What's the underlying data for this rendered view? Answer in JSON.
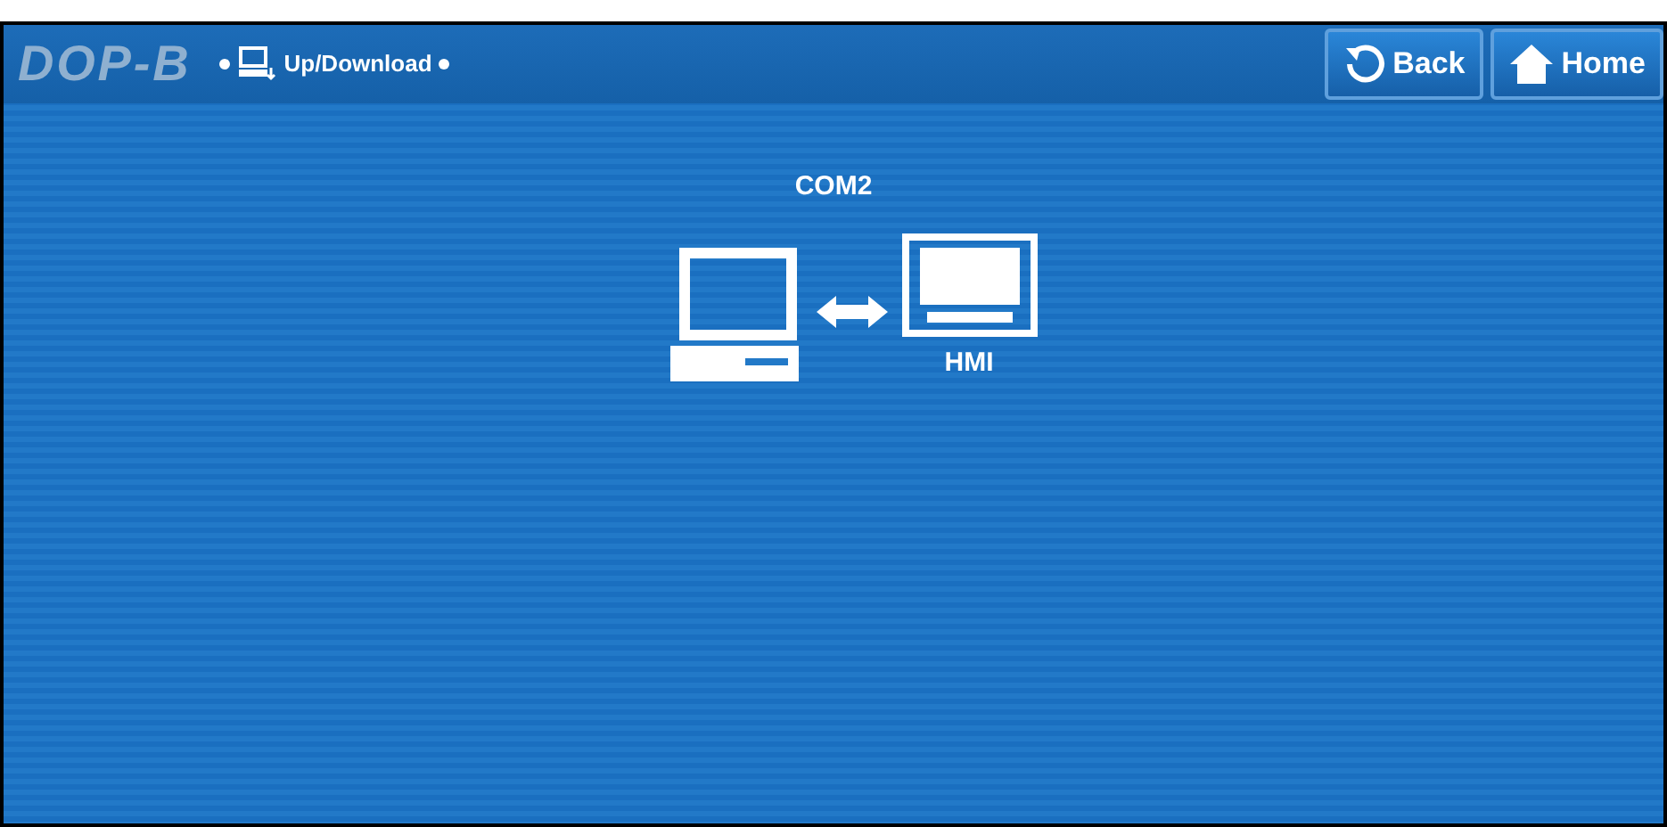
{
  "header": {
    "logo": "DOP-B",
    "breadcrumb": "Up/Download",
    "buttons": [
      {
        "kind": "back",
        "label": "Back"
      },
      {
        "kind": "home",
        "label": "Home"
      }
    ]
  },
  "connection": {
    "port": "COM2",
    "device": "HMI"
  }
}
